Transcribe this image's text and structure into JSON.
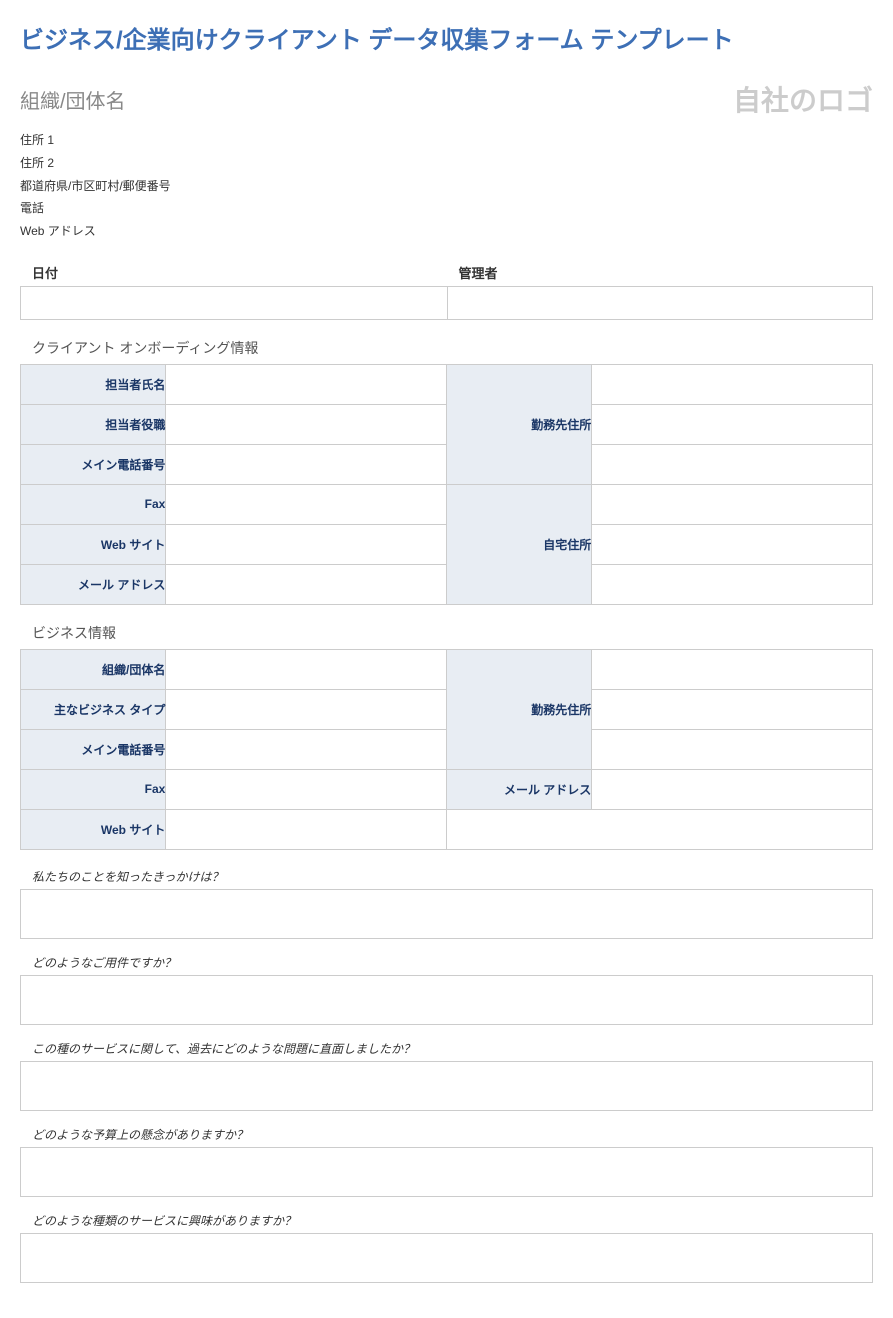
{
  "title": "ビジネス/企業向けクライアント データ収集フォーム テンプレート",
  "header": {
    "org_name_label": "組織/団体名",
    "logo_placeholder": "自社のロゴ"
  },
  "address": {
    "line1": "住所 1",
    "line2": "住所 2",
    "line3": "都道府県/市区町村/郵便番号",
    "line4": "電話",
    "line5": "Web アドレス"
  },
  "top_fields": {
    "date_label": "日付",
    "admin_label": "管理者"
  },
  "section1": {
    "heading": "クライアント オンボーディング情報",
    "contact_name": "担当者氏名",
    "contact_title": "担当者役職",
    "main_phone": "メイン電話番号",
    "fax": "Fax",
    "website": "Web サイト",
    "email": "メール アドレス",
    "work_address": "勤務先住所",
    "home_address": "自宅住所"
  },
  "section2": {
    "heading": "ビジネス情報",
    "org_name": "組織/団体名",
    "biz_type": "主なビジネス タイプ",
    "main_phone": "メイン電話番号",
    "fax": "Fax",
    "website": "Web サイト",
    "work_address": "勤務先住所",
    "email": "メール アドレス"
  },
  "questions": {
    "q1": "私たちのことを知ったきっかけは？",
    "q2": "どのようなご用件ですか？",
    "q3": "この種のサービスに関して、過去にどのような問題に直面しましたか？",
    "q4": "どのような予算上の懸念がありますか？",
    "q5": "どのような種類のサービスに興味がありますか？"
  }
}
